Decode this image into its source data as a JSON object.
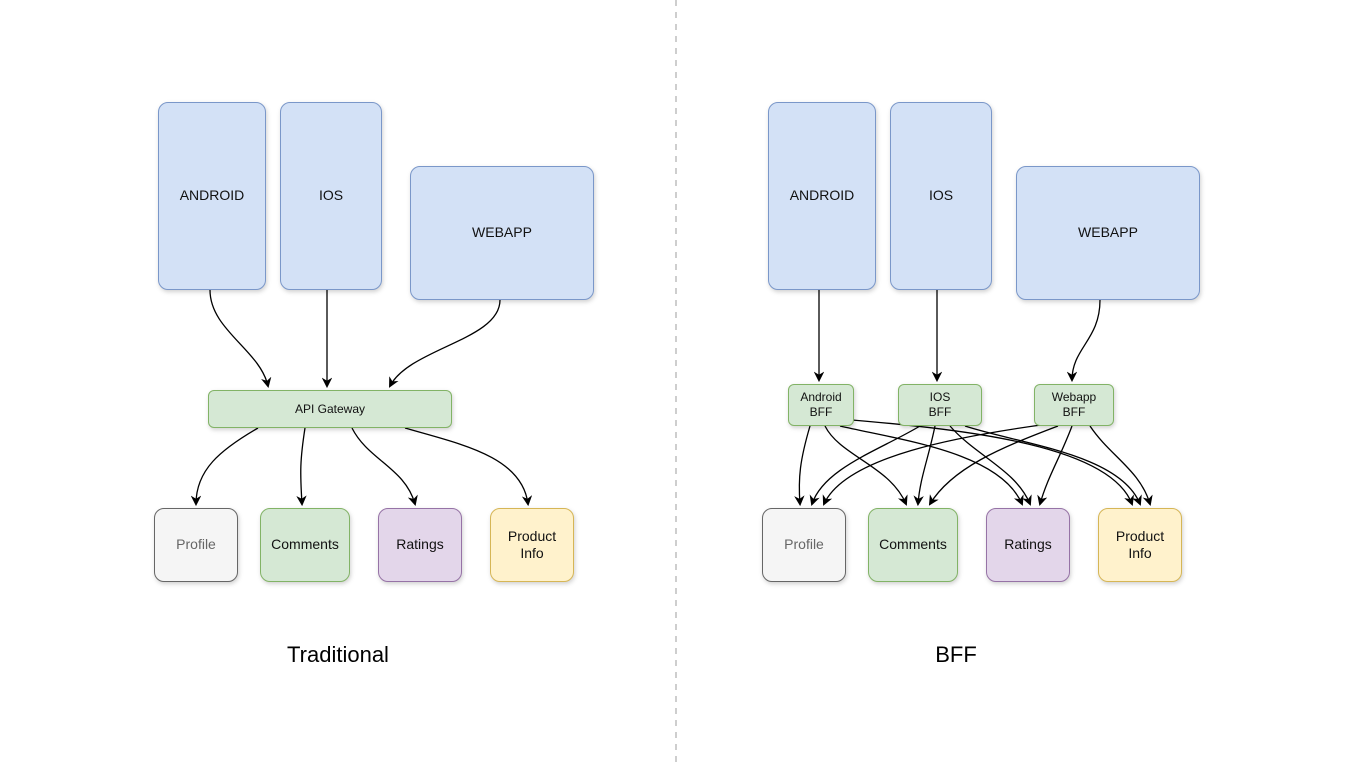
{
  "left": {
    "title": "Traditional",
    "clients": {
      "android": "ANDROID",
      "ios": "IOS",
      "webapp": "WEBAPP"
    },
    "gateway": "API Gateway",
    "services": {
      "profile": "Profile",
      "comments": "Comments",
      "ratings": "Ratings",
      "product": "Product\nInfo"
    }
  },
  "right": {
    "title": "BFF",
    "clients": {
      "android": "ANDROID",
      "ios": "IOS",
      "webapp": "WEBAPP"
    },
    "bffs": {
      "android": "Android\nBFF",
      "ios": "IOS\nBFF",
      "webapp": "Webapp\nBFF"
    },
    "services": {
      "profile": "Profile",
      "comments": "Comments",
      "ratings": "Ratings",
      "product": "Product\nInfo"
    }
  }
}
